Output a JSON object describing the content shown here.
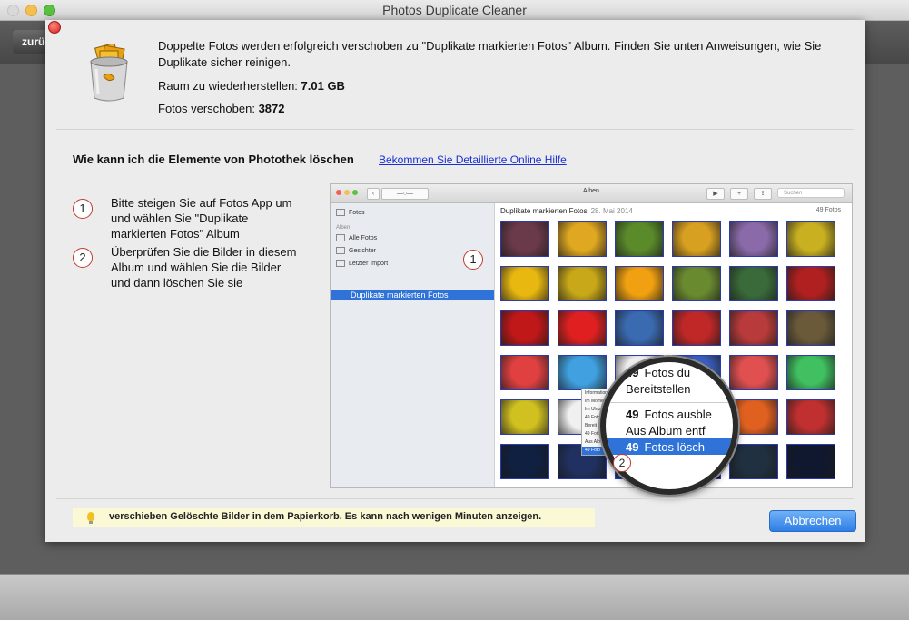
{
  "window": {
    "title": "Photos Duplicate Cleaner"
  },
  "toolbar": {
    "back_label": "zurüc"
  },
  "sheet": {
    "message": "Doppelte Fotos werden erfolgreich verschoben zu \"Duplikate markierten Fotos\" Album. Finden Sie unten Anweisungen, wie Sie Duplikate sicher reinigen.",
    "restore_label": "Raum zu wiederherstellen:",
    "restore_value": "7.01 GB",
    "moved_label": "Fotos verschoben:",
    "moved_value": "3872",
    "howto_heading": "Wie kann ich die Elemente von Photothek löschen",
    "help_link": "Bekommen Sie Detaillierte Online Hilfe",
    "steps": [
      {
        "num": "1",
        "text": "Bitte steigen Sie auf Fotos App um und wählen Sie \"Duplikate markierten Fotos\" Album"
      },
      {
        "num": "2",
        "text": "Überprüfen Sie die Bilder in diesem Album und wählen Sie die Bilder und dann löschen Sie sie"
      }
    ],
    "tip": "verschieben Gelöschte Bilder in dem Papierkorb. Es kann nach wenigen Minuten anzeigen.",
    "cancel_label": "Abbrechen"
  },
  "screenshot": {
    "window_title": "Alben",
    "search_placeholder": "Suchen",
    "sidebar": {
      "top": "Fotos",
      "section": "Alben",
      "items": [
        "Alle Fotos",
        "Gesichter",
        "Letzter Import"
      ],
      "selected": "Duplikate markierten Fotos"
    },
    "album_title": "Duplikate markierten Fotos",
    "album_date": "28. Mai 2014",
    "album_count": "49 Fotos",
    "badge1": "1",
    "badge2": "2",
    "context_menu": [
      "Informationen",
      "Im Moment",
      "Im Uhrze",
      "49 Foto",
      "Bereit",
      "49 Foto",
      "Aus Alb",
      "49 Foto"
    ],
    "magnifier": {
      "line1_num": "49",
      "line1_text": "Fotos du",
      "line2": "Bereitstellen",
      "line3_num": "49",
      "line3_text": "Fotos ausble",
      "line4": "Aus Album entf",
      "line5_num": "49",
      "line5_text": "Fotos lösch"
    },
    "thumb_colors": [
      [
        "#6b3a4a",
        "#e0a820",
        "#5a8a2a",
        "#d8a020",
        "#8a6aa8",
        "#c8b020"
      ],
      [
        "#e8b810",
        "#c8a818",
        "#f0a010",
        "#6a8a30",
        "#3a6a3a",
        "#b02020"
      ],
      [
        "#c01818",
        "#e02020",
        "#3a6ab0",
        "#c02828",
        "#b83a3a",
        "#6a5a3a"
      ],
      [
        "#e04040",
        "#40a0e0",
        "#f0f0f0",
        "#3a60c0",
        "#e05050",
        "#40c060"
      ],
      [
        "#d0c020",
        "#f0f0f0",
        "#d05030",
        "#3040a0",
        "#e06020",
        "#c03030"
      ],
      [
        "#102040",
        "#203060",
        "#2060c0",
        "#102050",
        "#203040",
        "#101830"
      ]
    ]
  }
}
